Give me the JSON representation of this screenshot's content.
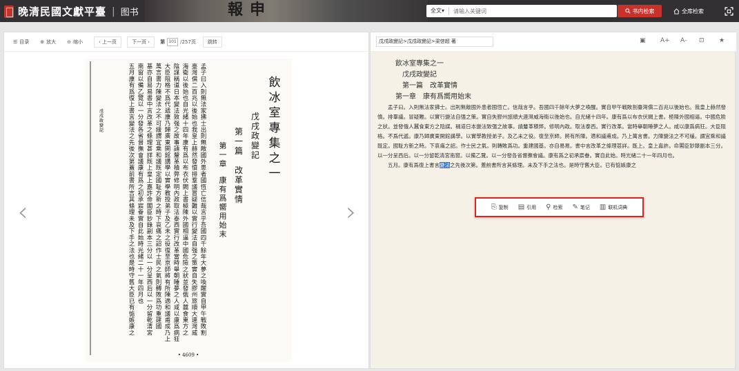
{
  "header": {
    "logo_title": "晚清民國文獻平臺",
    "separator": "|",
    "section": "图书",
    "banner_chars": [
      "報",
      "申"
    ],
    "search": {
      "scope": "全文▾",
      "placeholder": "请输入关键词"
    },
    "btn_in_book": "书内检索",
    "btn_all": "全库检索",
    "search_icon": "search-icon",
    "home_icon": "home-icon",
    "fullscreen_icon": "fullscreen-icon",
    "accent": "#c8322a"
  },
  "viewer_toolbar": {
    "toc": "目录",
    "zoom_in": "放大",
    "zoom_out": "缩小",
    "prev": "‹ 上一页",
    "next": "下一页 ›",
    "page_prefix": "第",
    "page_value": "101",
    "page_total": "/257页",
    "jump": "跳转"
  },
  "scan": {
    "title": "飲冰室專集之一",
    "book": "戊戌政變記",
    "part": "第一篇",
    "part_title": "改革實情",
    "chapter": "第一章",
    "chapter_title": "康有爲嚮用始末",
    "margin_note": "戊戌政變記",
    "page_number": "• 4609 •",
    "columns": [
      "孟子曰入則無法家拂士出則無敵國外患者國恆亡信哉言乎吾國四千餘年大夢之喚醒實自甲午戰敗割",
      "臺灣償二百兆以後始也我皇上赫然發憤排羣議冒疑難以實行變法自强之策實自失膠州旅順大連灣威",
      "海衛以後始也自光緒十四年康有爲以布衣伏闕上書極陳外國相逼中國危險之狀並發俄人蠶食東方之",
      "陰謀稱道日本變法致强之故事請釐革積弊修明內政取法泰西實行改革當時舉朝睡夢之人咸以康爲病狂",
      "大臣阻格不爲代遞康乃歸廣東開館講學以實學教授弟子及乙未之役復至京師將有所陳適和議甫成乃上",
      "萬言書力陳變法之不可緩謂宜乘和議既定國耻方新之時下哀痛之詔作士民之氣則轉敗爲功重建國",
      "基亦自易易書中言改革之條理甚詳既上皇上嘉許命閣臣鈔錄副本三分以一分呈西后以一分留乾清宮",
      "南窗以備乙覽以一分發各省督撫會議康有爲之初承宸眷實自此始時光緒二十一年四月也",
      "五月康有爲復上書言變法之先後次第蓋前書所言其條理未及下手之法也是時守舊大臣已有惦嫉康之"
    ]
  },
  "reader_toolbar": {
    "breadcrumb": "戊戌政變記>戊戌政變記>梁啓超 著",
    "image_icon": "image-icon",
    "font_bigger": "A+",
    "font_smaller": "A-",
    "layout_icon": "layout-icon",
    "star_icon": "star-icon"
  },
  "reader_text": {
    "lines": [
      "飲冰室專集之一",
      "戊戌政變記",
      "第一篇　改革實情",
      "第一章　康有爲嚮用始末"
    ],
    "para1": "孟子曰。入則無法家拂士。出則無敵國外患者國恆亡。信哉言乎。吾國四千餘年大夢之喚醒。實自甲午戰敗割臺灣償二百兆以後始也。我皇上赫然發憤。排羣議。冒疑難。以實行變法自强之策。實自失膠州旅順大連灣威海衛以後始也。自光緒十四年。康有爲以布衣伏闕上書。極陳外國相逼。中國危險之狀。並發俄人蠶食東方之陰謀。稱道日本變法致强之故事。請釐革積弊。修明內政。取法泰西。實行改革。當時舉朝睡夢之人。咸以康爲病狂。大臣阻格。不爲代遞。康乃歸廣東開館講學。以實學教授弟子。及乙未之役。復至京師。將有所陳。適和議甫成。乃上萬言書。力陳變法之不可緩。謂宜乘和議既定。國耻方新之時。下哀痛之詔。作士民之氣。則轉敗爲功。重建國基。亦自易易。書中言改革之條理甚詳。既上。皇上嘉許。命閣臣鈔錄副本三分。以一分呈西后。以一分留乾清宮南窗。以備乙覽。以一分發各省督撫會議。康有爲之初承宸眷。實自此始。時光緒二十一年四月也。",
    "para2_before": "五月。康有爲復上書言",
    "para2_selected": "變法",
    "para2_after": "之先後次第。蓋前書所言其條理。未及下手之法也。是時守舊大臣。已有惦嫉康之"
  },
  "popup": {
    "copy": "复制",
    "cite": "引用",
    "search": "检索",
    "note": "笔记",
    "dict": "联机词典",
    "border_color": "#e0211e"
  }
}
